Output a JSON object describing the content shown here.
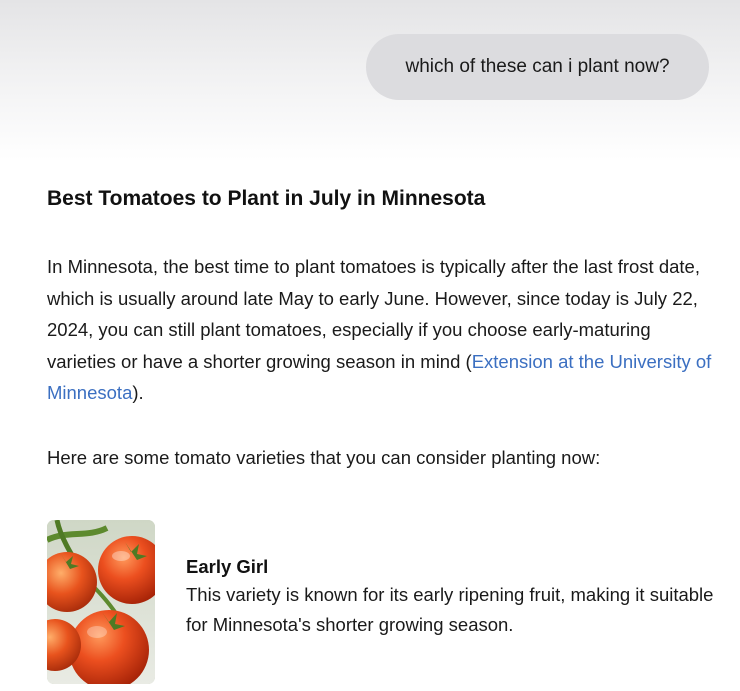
{
  "conversation": {
    "user_message": "which of these can i plant now?"
  },
  "answer": {
    "heading": "Best Tomatoes to Plant in July in Minnesota",
    "intro_text": "In Minnesota, the best time to plant tomatoes is typically after the last frost date, which is usually around late May to early June. However, since today is July 22, 2024, you can still plant tomatoes, especially if you choose early-maturing varieties or have a shorter growing season in mind (",
    "source_link": "Extension at the University of Minnesota",
    "intro_end": ").",
    "list_intro": "Here are some tomato varieties that you can consider planting now:",
    "varieties": [
      {
        "name": "Early Girl",
        "description": "This variety is known for its early ripening fruit, making it suitable for Minnesota's shorter growing season.",
        "image_icon": "tomato-vine-photo"
      }
    ]
  },
  "colors": {
    "link": "#3b6fc1",
    "user_bubble": "#dcdcdf",
    "tomato": "#e2461c",
    "vine": "#5d8a2e"
  }
}
